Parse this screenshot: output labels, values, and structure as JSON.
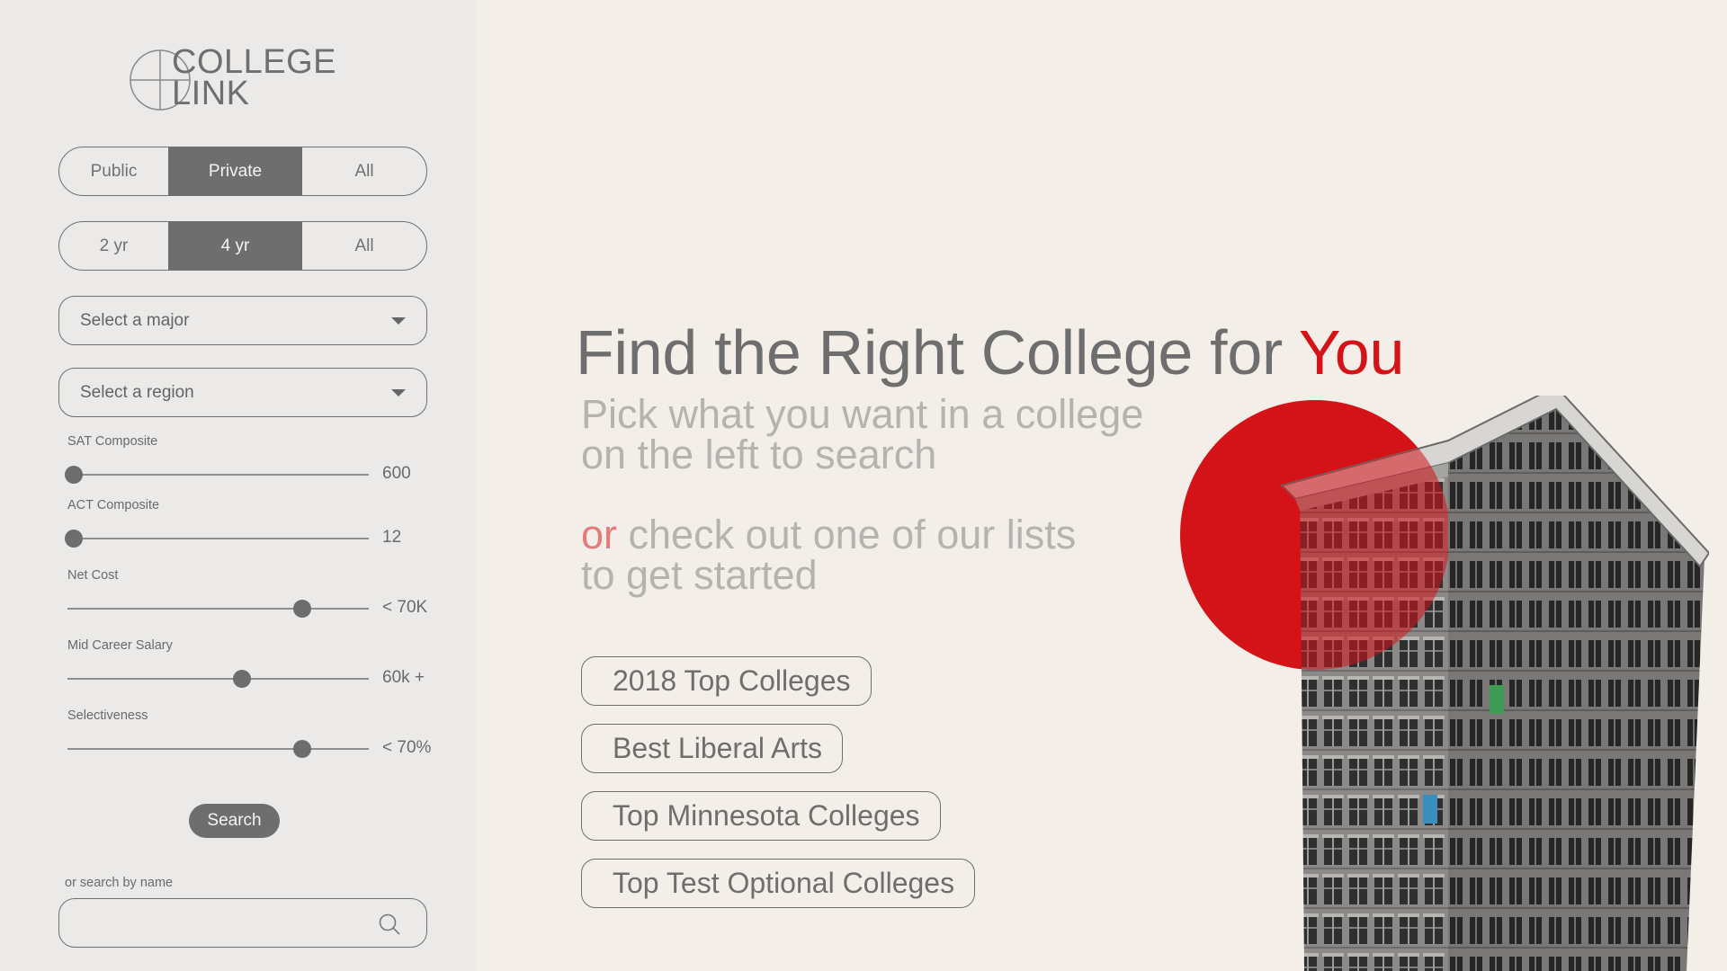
{
  "logo": {
    "line1": "COLLEGE",
    "line2": "LINK"
  },
  "filters": {
    "ownership": {
      "options": [
        {
          "label": "Public",
          "active": false
        },
        {
          "label": "Private",
          "active": true
        },
        {
          "label": "All",
          "active": false
        }
      ]
    },
    "length": {
      "options": [
        {
          "label": "2 yr",
          "active": false
        },
        {
          "label": "4 yr",
          "active": true
        },
        {
          "label": "All",
          "active": false
        }
      ]
    },
    "major": {
      "placeholder": "Select a major"
    },
    "region": {
      "placeholder": "Select a region"
    },
    "sliders": [
      {
        "label": "SAT Composite",
        "value_text": "600",
        "level": 0.02
      },
      {
        "label": "ACT Composite",
        "value_text": "12",
        "level": 0.02
      },
      {
        "label": "Net Cost",
        "value_text": "< 70K",
        "level": 0.78
      },
      {
        "label": "Mid Career Salary",
        "value_text": "60k +",
        "level": 0.58
      },
      {
        "label": "Selectiveness",
        "value_text": "< 70%",
        "level": 0.78
      }
    ],
    "search_label": "Search",
    "name_search": {
      "label": "or search by name",
      "value": ""
    }
  },
  "hero": {
    "headline": "Find the Right College for ",
    "headline_accent": "You",
    "sub1_line1": "Pick what you want in a college",
    "sub1_line2": "on the left to search",
    "sub2_or": "or",
    "sub2_line1": " check out one of our lists",
    "sub2_line2": "to get started"
  },
  "lists": [
    "2018 Top Colleges",
    "Best Liberal Arts",
    "Top Minnesota Colleges",
    "Top Test Optional Colleges"
  ],
  "colors": {
    "accent": "#d41318",
    "active_segment": "#6e6e6e",
    "sidebar_bg": "#ebeae8",
    "main_bg": "#f3efe8"
  }
}
